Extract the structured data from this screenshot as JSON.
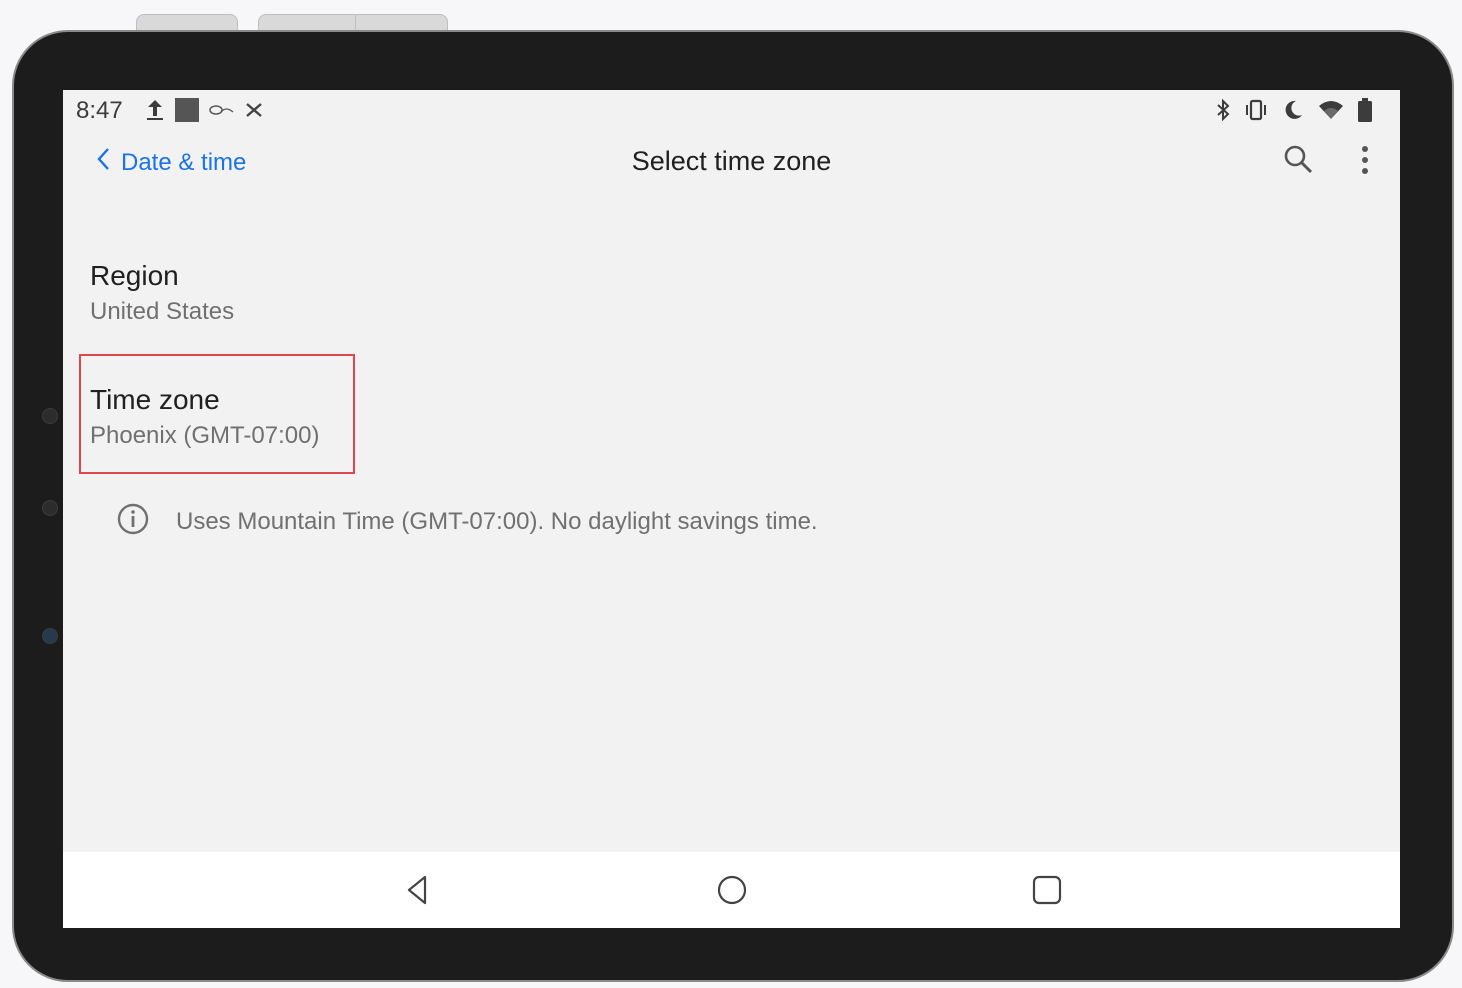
{
  "status_bar": {
    "time": "8:47",
    "left_icons": [
      "upload-icon",
      "notification-square-icon",
      "app-notification-icon",
      "bug-icon"
    ],
    "right_icons": [
      "bluetooth-icon",
      "vibrate-icon",
      "do-not-disturb-moon-icon",
      "wifi-icon",
      "battery-icon"
    ]
  },
  "app_bar": {
    "back_label": "Date & time",
    "title": "Select time zone"
  },
  "preferences": {
    "region": {
      "title": "Region",
      "summary": "United States"
    },
    "time_zone": {
      "title": "Time zone",
      "summary": "Phoenix (GMT-07:00)"
    }
  },
  "footer": {
    "info_text": "Uses Mountain Time (GMT-07:00). No daylight savings time."
  },
  "colors": {
    "accent": "#1a73e8",
    "highlight_box": "#e0474c",
    "background": "#f2f2f2"
  }
}
